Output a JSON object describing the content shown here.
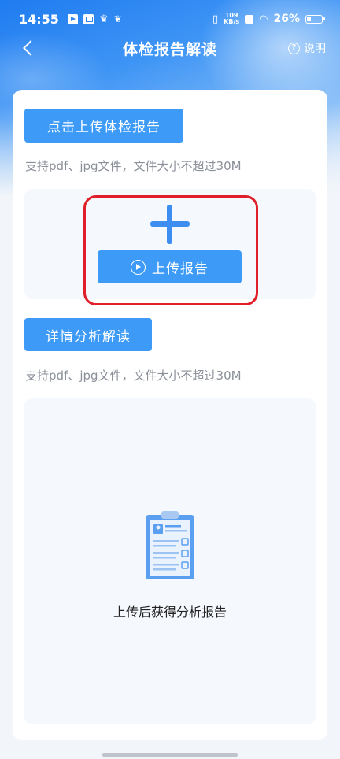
{
  "status_bar": {
    "time": "14:55",
    "net_speed_value": "109",
    "net_speed_unit": "KB/s",
    "battery_percent": "26%"
  },
  "nav": {
    "title": "体检报告解读",
    "help_label": "说明"
  },
  "upload_section": {
    "button_label": "点击上传体检报告",
    "hint": "支持pdf、jpg文件，文件大小不超过30M",
    "upload_button_label": "上传报告"
  },
  "detail_section": {
    "button_label": "详情分析解读",
    "hint": "支持pdf、jpg文件，文件大小不超过30M",
    "empty_state_text": "上传后获得分析报告"
  },
  "colors": {
    "accent": "#3d9bf7",
    "highlight_border": "#e11f2a",
    "area_bg": "#f5f8fc"
  }
}
